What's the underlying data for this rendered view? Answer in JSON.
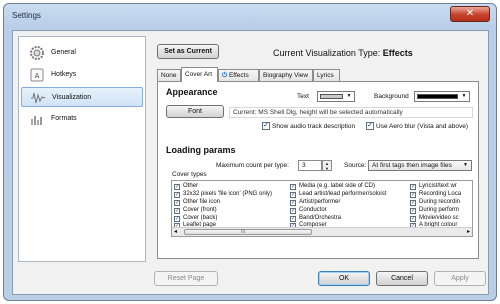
{
  "window": {
    "title": "Settings",
    "close_glyph": "✕"
  },
  "sidebar": {
    "items": [
      {
        "label": "General",
        "icon": "gear-icon"
      },
      {
        "label": "Hotkeys",
        "icon": "keyboard-key-icon"
      },
      {
        "label": "Visualization",
        "icon": "waveform-icon",
        "selected": true
      },
      {
        "label": "Formats",
        "icon": "bars-icon"
      }
    ]
  },
  "header": {
    "set_current_label": "Set as Current",
    "viz_type_label": "Current Visualization Type:",
    "viz_type_value": "Effects"
  },
  "tabs": [
    {
      "label": "None"
    },
    {
      "label": "Cover Art",
      "active": true
    },
    {
      "label": "Effects"
    },
    {
      "label": "Biography View"
    },
    {
      "label": "Lyrics"
    }
  ],
  "appearance": {
    "heading": "Appearance",
    "text_label": "Text",
    "text_color": "#c8c8c8",
    "background_label": "Background",
    "background_color": "#000000",
    "font_button": "Font",
    "font_status": "Current: MS Shell Dlg, height will be selected automatically",
    "show_audio_label": "Show audio track description",
    "show_audio_checked": true,
    "aero_blur_label": "Use Aero blur (Vista and above)",
    "aero_blur_checked": true
  },
  "loading": {
    "heading": "Loading params",
    "max_count_label": "Maximum count per type:",
    "max_count_value": "3",
    "source_label": "Source:",
    "source_value": "At first tags then image files",
    "cover_types_label": "Cover types",
    "columns": [
      [
        "Other",
        "32x32 pixels 'file icon' (PNG only)",
        "Other file icon",
        "Cover (front)",
        "Cover (back)",
        "Leaflet page"
      ],
      [
        "Media (e.g. label side of CD)",
        "Lead artist/lead performer/soloist",
        "Artist/performer",
        "Conductor",
        "Band/Orchestra",
        "Composer"
      ],
      [
        "Lyricist/text wr",
        "Recording Loca",
        "During recordin",
        "During perform",
        "Movie/video sc",
        "A bright colour"
      ]
    ],
    "scroll_left": "◂",
    "scroll_right": "▸",
    "scroll_grip": "III"
  },
  "footer": {
    "reset_label": "Reset Page",
    "ok_label": "OK",
    "cancel_label": "Cancel",
    "apply_label": "Apply"
  },
  "colors": {
    "accent": "#3c7fb1",
    "selection": "#cfe3f8"
  }
}
